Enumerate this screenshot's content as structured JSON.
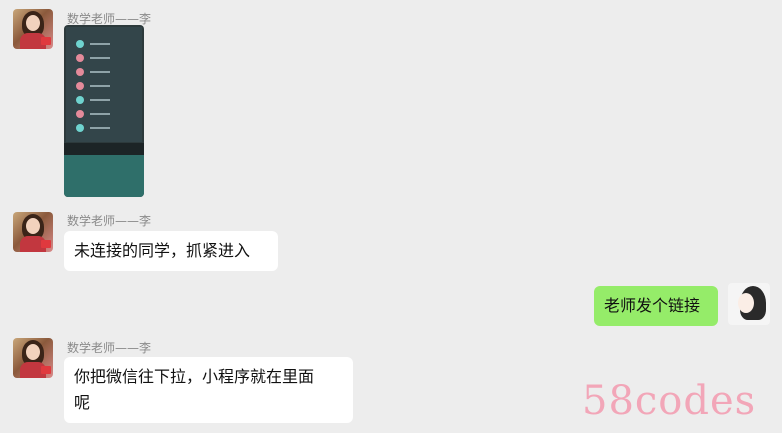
{
  "messages": {
    "m1": {
      "sender": "数学老师——李"
    },
    "m2": {
      "sender": "数学老师——李",
      "text": "未连接的同学，抓紧进入"
    },
    "m3": {
      "text": "老师发个链接"
    },
    "m4": {
      "sender": "数学老师——李",
      "text_line1": "你把微信往下拉，小程序就在里面",
      "text_line2": "呢"
    }
  },
  "watermark": {
    "text": "58codes"
  },
  "colors": {
    "background": "#ededed",
    "bubble_in": "#ffffff",
    "bubble_out": "#95ec69",
    "watermark": "#f2a6b8"
  }
}
